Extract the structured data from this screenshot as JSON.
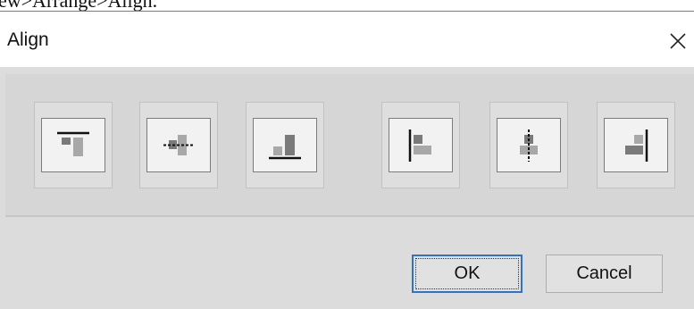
{
  "breadcrumb": "ew>Arrange>Align.",
  "dialog": {
    "title": "Align",
    "close_glyph": "×"
  },
  "align_buttons": [
    {
      "name": "align-top",
      "icon": "align-top-icon"
    },
    {
      "name": "align-middle",
      "icon": "align-vertical-center-icon"
    },
    {
      "name": "align-bottom",
      "icon": "align-bottom-icon"
    },
    {
      "name": "align-left",
      "icon": "align-left-icon"
    },
    {
      "name": "align-center",
      "icon": "align-horizontal-center-icon"
    },
    {
      "name": "align-right",
      "icon": "align-right-icon"
    }
  ],
  "buttons": {
    "ok_label": "OK",
    "cancel_label": "Cancel"
  },
  "colors": {
    "icon_bar_light": "#a8a8a8",
    "icon_bar_dark": "#6e6e6e",
    "icon_line": "#111111",
    "ok_border": "#2f72c9"
  }
}
